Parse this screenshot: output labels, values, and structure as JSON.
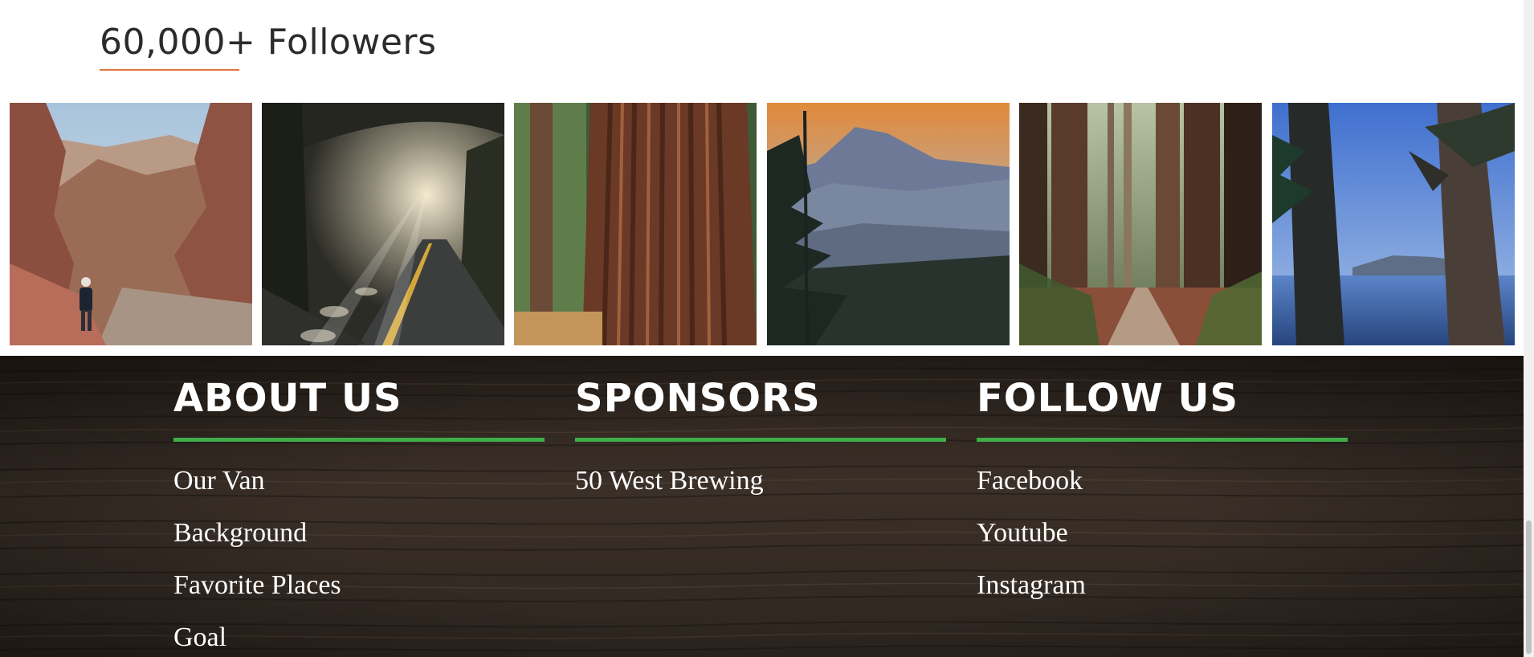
{
  "followers": {
    "title": "60,000+ Followers",
    "accent_color": "#e0743b"
  },
  "gallery": {
    "photos": [
      {
        "subject": "hiker in red rock canyon"
      },
      {
        "subject": "foggy tree tunnel road"
      },
      {
        "subject": "redwood trunk close-up"
      },
      {
        "subject": "mountain sunset over forest"
      },
      {
        "subject": "redwood forest dirt path"
      },
      {
        "subject": "crater lake through trees"
      }
    ]
  },
  "footer": {
    "accent_color": "#3fae49",
    "columns": [
      {
        "heading": "ABOUT US",
        "links": [
          "Our Van",
          "Background",
          "Favorite Places",
          "Goal"
        ]
      },
      {
        "heading": "SPONSORS",
        "links": [
          "50 West Brewing"
        ]
      },
      {
        "heading": "FOLLOW US",
        "links": [
          "Facebook",
          "Youtube",
          "Instagram"
        ]
      }
    ]
  }
}
